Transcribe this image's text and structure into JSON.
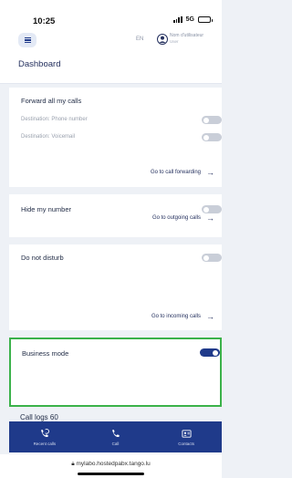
{
  "status_bar": {
    "time": "10:25",
    "network": "5G"
  },
  "header": {
    "language": "EN",
    "user_name": "Nom d'utilisateur",
    "user_role": "User",
    "page_title": "Dashboard"
  },
  "cards": {
    "forward": {
      "title": "Forward all my calls",
      "destination_phone": "Destination: Phone number",
      "destination_voicemail": "Destination: Voicemail",
      "link": "Go to call forwarding",
      "phone_enabled": false,
      "voicemail_enabled": false
    },
    "hide_number": {
      "title": "Hide my number",
      "link": "Go to outgoing calls",
      "enabled": false
    },
    "do_not_disturb": {
      "title": "Do not disturb",
      "link": "Go to incoming calls",
      "enabled": false
    },
    "business_mode": {
      "title": "Business mode",
      "enabled": true,
      "highlight_color": "#3bb24a"
    }
  },
  "call_logs": {
    "label": "Call logs 60"
  },
  "bottom_nav": {
    "recent_calls": "Recent calls",
    "call": "Call",
    "contacts": "Contacts"
  },
  "browser": {
    "url": "mylabo.hostedpabx.tango.lu"
  },
  "colors": {
    "primary": "#1f3a8a",
    "toggle_off": "#c9ced8",
    "background": "#eef1f6"
  }
}
